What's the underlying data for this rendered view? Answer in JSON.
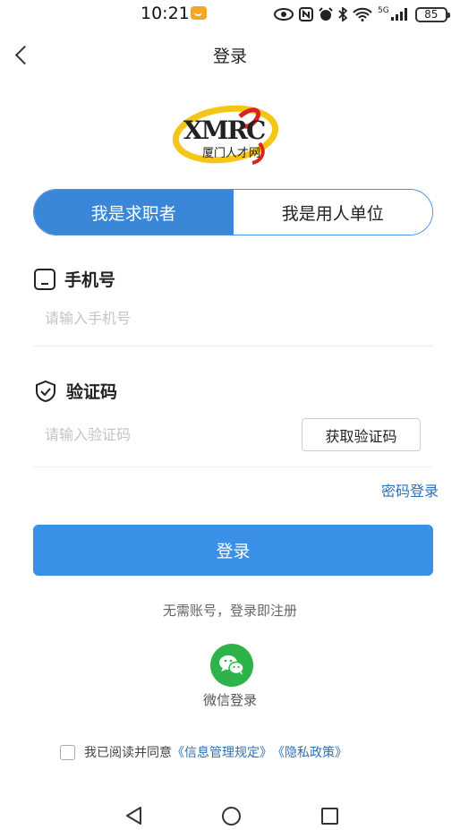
{
  "status_bar": {
    "time": "10:21",
    "battery": "85",
    "icons": [
      "eye-icon",
      "nfc-icon",
      "alarm-icon",
      "bluetooth-icon",
      "wifi-icon",
      "signal-icon"
    ],
    "signal_label": "5G"
  },
  "header": {
    "title": "登录"
  },
  "logo": {
    "text": "XMRC",
    "subtitle": "厦门人才网"
  },
  "role_toggle": {
    "job_seeker": "我是求职者",
    "employer": "我是用人单位",
    "selected": "job_seeker"
  },
  "phone": {
    "label": "手机号",
    "placeholder": "请输入手机号",
    "value": ""
  },
  "code": {
    "label": "验证码",
    "placeholder": "请输入验证码",
    "value": "",
    "get_code_button": "获取验证码"
  },
  "password_login": "密码登录",
  "login_button": "登录",
  "register_hint": "无需账号，登录即注册",
  "wechat": {
    "label": "微信登录"
  },
  "agreement": {
    "prefix": "我已阅读并同意",
    "link1": "《信息管理规定》",
    "link2": "《隐私政策》",
    "checked": false
  },
  "colors": {
    "primary": "#3a8fe6",
    "toggle_active": "#3a87d8",
    "link": "#2f6fb5",
    "wechat": "#2db34a",
    "logo_ring": "#f5c518",
    "logo_accent": "#d9261c"
  }
}
